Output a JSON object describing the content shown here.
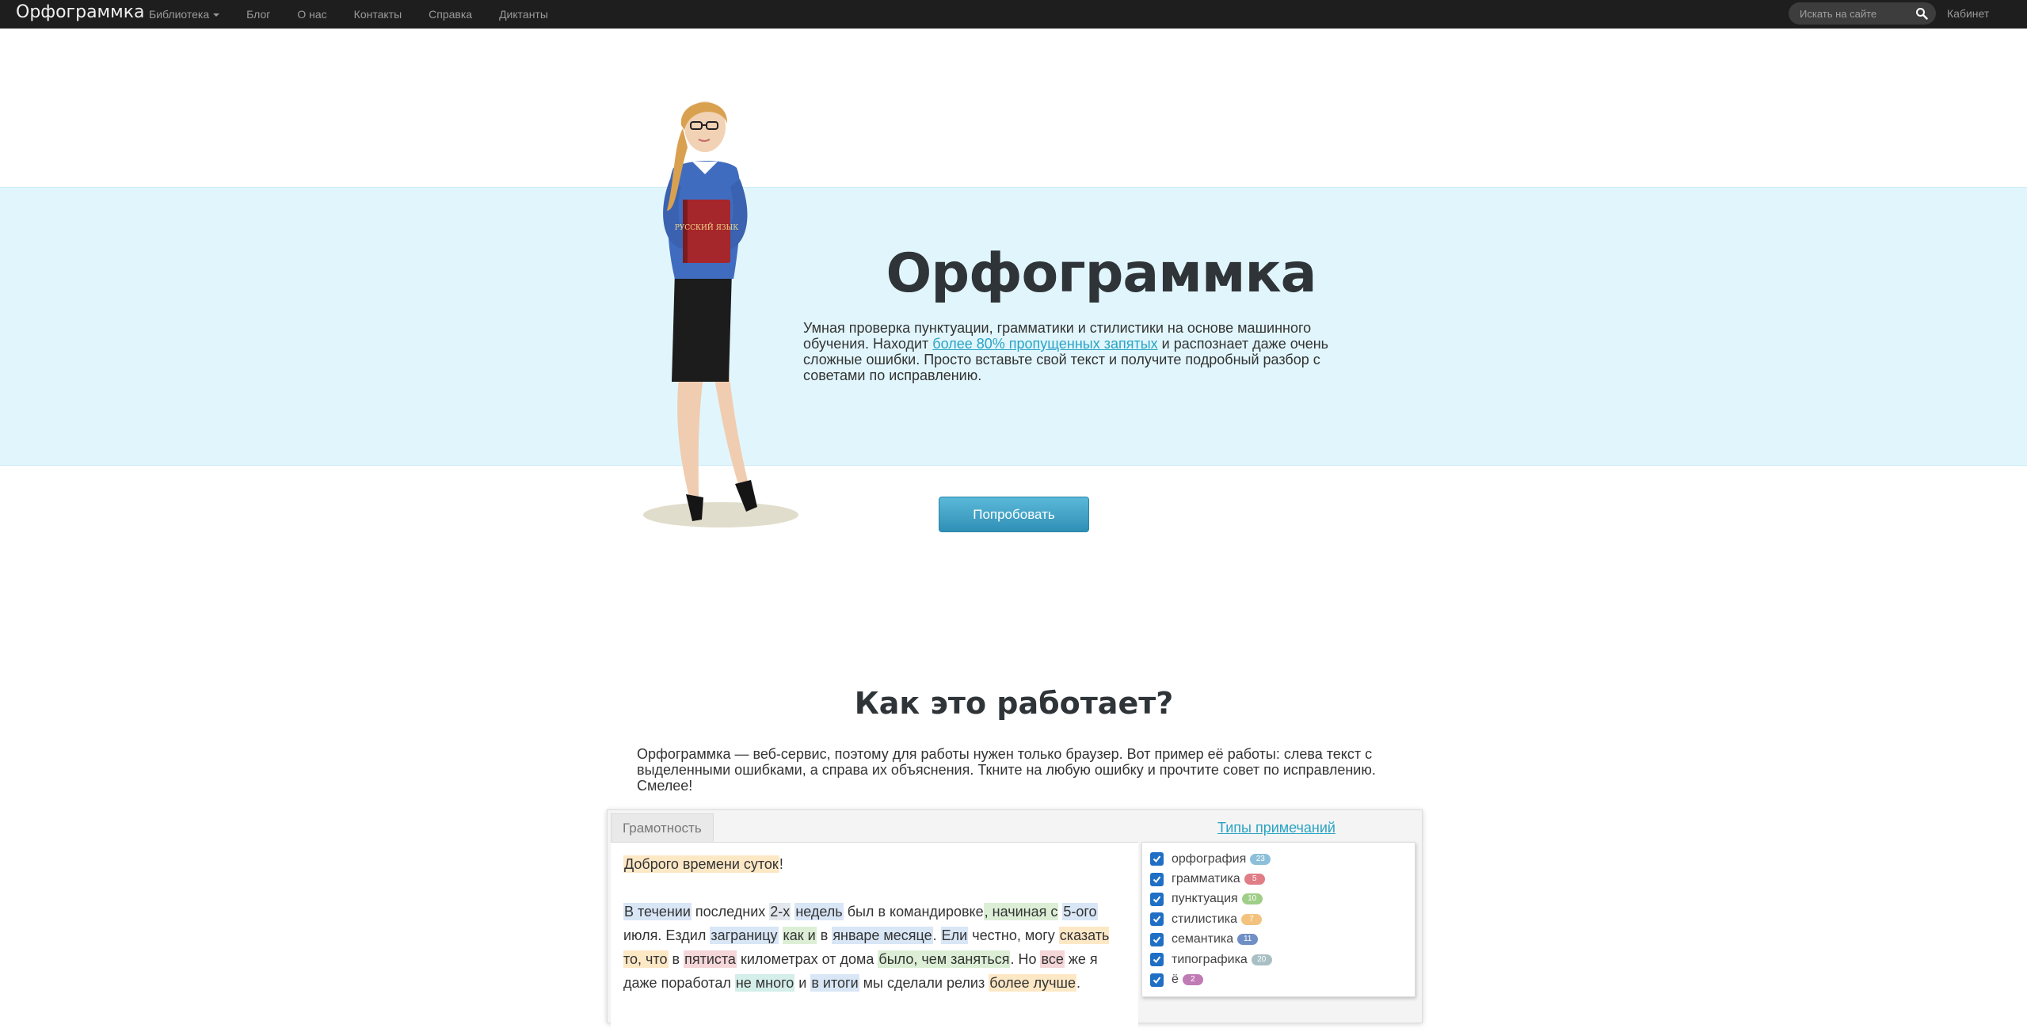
{
  "nav": {
    "brand": "Орфограммка",
    "links": [
      {
        "label": "Библиотека"
      },
      {
        "label": "Блог"
      },
      {
        "label": "О нас"
      },
      {
        "label": "Контакты"
      },
      {
        "label": "Справка"
      },
      {
        "label": "Диктанты"
      }
    ],
    "search_placeholder": "Искать на сайте",
    "cabinet": "Кабинет"
  },
  "hero": {
    "title": "Орфограммка",
    "text_before": "Умная проверка пунктуации, грамматики и стилистики на основе машинного обучения. Находит ",
    "link": "более 80% пропущенных запятых",
    "text_after": " и распознает даже очень сложные ошибки. Просто вставьте свой текст и получите подробный разбор с советами по исправлению.",
    "book_text": "РУССКИЙ ЯЗЫК",
    "button": "Попробовать"
  },
  "how": {
    "title": "Как это работает?",
    "text": "Орфограммка — веб-сервис, поэтому для работы нужен только браузер. Вот пример её работы: слева текст с выделенными ошибками, а справа их объяснения. Ткните на любую ошибку и прочтите совет по исправлению. Смелее!"
  },
  "demo": {
    "tab": "Грамотность",
    "types_link": "Типы примечаний",
    "p1": [
      {
        "t": "Доброго времени суток",
        "h": "orange"
      },
      {
        "t": "!",
        "h": ""
      }
    ],
    "p2": [
      {
        "t": "В течении",
        "h": "blue"
      },
      {
        "t": " последних ",
        "h": ""
      },
      {
        "t": "2-х",
        "h": "gray"
      },
      {
        "t": " ",
        "h": ""
      },
      {
        "t": "недель",
        "h": "blue"
      },
      {
        "t": " был в командировке",
        "h": ""
      },
      {
        "t": ", начиная с",
        "h": "green"
      },
      {
        "t": " ",
        "h": ""
      },
      {
        "t": "5-ого",
        "h": "blue"
      },
      {
        "t": " июля. Ездил ",
        "h": ""
      },
      {
        "t": "заграницу",
        "h": "blue"
      },
      {
        "t": " ",
        "h": ""
      },
      {
        "t": "как и",
        "h": "green"
      },
      {
        "t": " в ",
        "h": ""
      },
      {
        "t": "январе месяце",
        "h": "blue"
      },
      {
        "t": ". ",
        "h": ""
      },
      {
        "t": "Ели",
        "h": "blue"
      },
      {
        "t": " честно, могу ",
        "h": ""
      },
      {
        "t": "сказать то, что",
        "h": "orange"
      },
      {
        "t": " в ",
        "h": ""
      },
      {
        "t": "пятиста",
        "h": "pink"
      },
      {
        "t": " километрах от дома ",
        "h": ""
      },
      {
        "t": "было, чем заняться",
        "h": "green"
      },
      {
        "t": ". Но ",
        "h": ""
      },
      {
        "t": "все",
        "h": "pink"
      },
      {
        "t": " же я даже поработал ",
        "h": ""
      },
      {
        "t": "не много",
        "h": "teal"
      },
      {
        "t": " и ",
        "h": ""
      },
      {
        "t": "в итоги",
        "h": "blue"
      },
      {
        "t": " мы сделали релиз ",
        "h": ""
      },
      {
        "t": "более лучше",
        "h": "orange"
      },
      {
        "t": ".",
        "h": ""
      }
    ],
    "types": [
      {
        "label": "орфография",
        "badge": "23",
        "color": "#8cc0da"
      },
      {
        "label": "грамматика",
        "badge": "5",
        "color": "#e07d86"
      },
      {
        "label": "пунктуация",
        "badge": "10",
        "color": "#9fce88"
      },
      {
        "label": "стилистика",
        "badge": "7",
        "color": "#f2c27e"
      },
      {
        "label": "семантика",
        "badge": "11",
        "color": "#6f8fc7"
      },
      {
        "label": "типографика",
        "badge": "20",
        "color": "#a8bfc4"
      },
      {
        "label": "ё",
        "badge": "2",
        "color": "#c07bb4"
      }
    ]
  },
  "colors": {
    "navbar": "#1e1e1e",
    "hero_band": "#e1f6fc",
    "accent": "#2aa3c5",
    "checkbox": "#1f6fc5"
  }
}
